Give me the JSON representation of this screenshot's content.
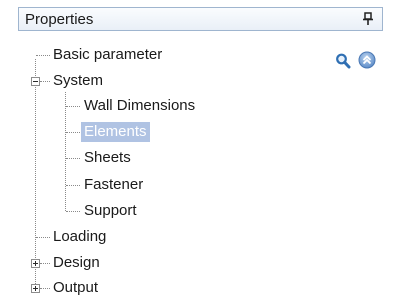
{
  "panel": {
    "title": "Properties"
  },
  "tree": {
    "basic_parameter": "Basic parameter",
    "system": {
      "label": "System",
      "state": "expanded",
      "children": {
        "wall_dimensions": "Wall Dimensions",
        "elements": "Elements",
        "sheets": "Sheets",
        "fastener": "Fastener",
        "support": "Support"
      }
    },
    "loading": "Loading",
    "design": {
      "label": "Design",
      "state": "collapsed"
    },
    "output": {
      "label": "Output",
      "state": "collapsed"
    }
  },
  "selected_item": "Elements",
  "icons": {
    "pin": "pin-icon",
    "search": "search-icon",
    "collapse_all": "collapse-all-icon"
  },
  "colors": {
    "selection": "#b0c3e3",
    "header_border": "#9fb5cf",
    "accent_blue": "#3d79b8"
  }
}
